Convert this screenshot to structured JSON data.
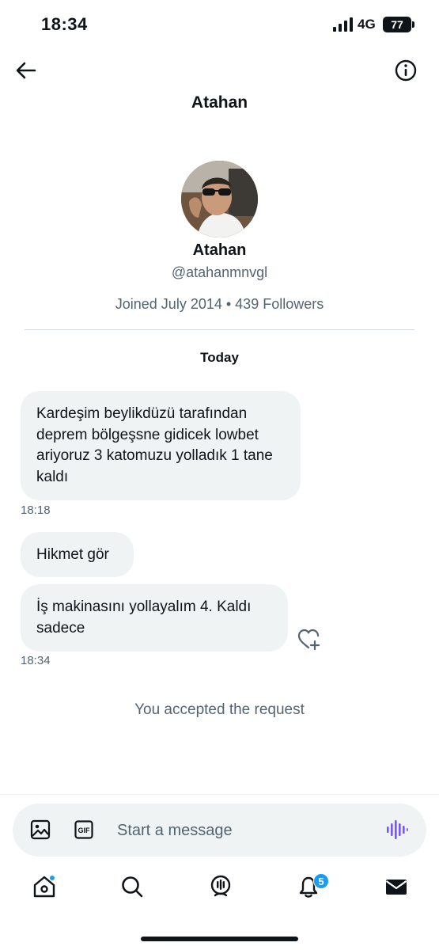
{
  "status_bar": {
    "time": "18:34",
    "network": "4G",
    "battery": "77"
  },
  "header": {
    "title": "Atahan",
    "back_icon": "arrow-left-icon",
    "info_icon": "info-icon"
  },
  "profile": {
    "name": "Atahan",
    "handle": "@atahanmnvgl",
    "meta": "Joined July 2014 • 439 Followers"
  },
  "conversation": {
    "date_header": "Today",
    "messages": [
      {
        "text": "Kardeşim beylikdüzü tarafından deprem bölgeşsne gidicek lowbet ariyoruz 3 katomuzu yolladık 1 tane kaldı"
      },
      {
        "text": "Hikmet gör"
      },
      {
        "text": "İş makinasını yollayalım 4. Kaldı sadece"
      }
    ],
    "timestamps": [
      "18:18",
      "18:34"
    ],
    "system_note": "You accepted the request"
  },
  "composer": {
    "placeholder": "Start a message",
    "gif_label": "GIF"
  },
  "tab_bar": {
    "items": [
      "home-icon",
      "search-icon",
      "spaces-icon",
      "notifications-icon",
      "messages-icon"
    ],
    "notifications_badge": "5"
  },
  "colors": {
    "accent": "#1d9bf0",
    "voice": "#7856ff",
    "bubble": "#eff3f4",
    "secondary_text": "#536471"
  }
}
